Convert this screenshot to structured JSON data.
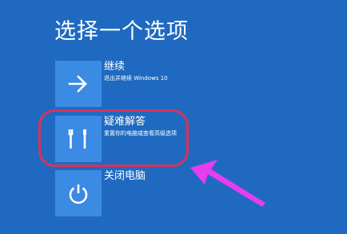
{
  "page": {
    "title": "选择一个选项"
  },
  "options": [
    {
      "label": "继续",
      "description": "退出并继续 Windows 10",
      "icon": "arrow-right-icon"
    },
    {
      "label": "疑难解答",
      "description": "重置你的电脑或查看高级选项",
      "icon": "tools-icon"
    },
    {
      "label": "关闭电脑",
      "description": "",
      "icon": "power-icon"
    }
  ],
  "colors": {
    "background": "#1f6ac0",
    "tile": "#3b8ae3",
    "highlight": "#d9325a",
    "annotation_arrow": "#e83cf0"
  }
}
